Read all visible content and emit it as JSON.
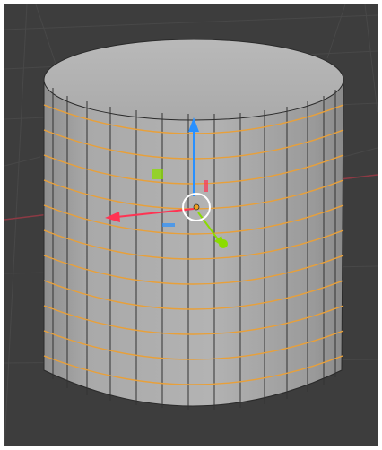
{
  "app": "Blender",
  "viewport": {
    "mode": "3d-viewport",
    "background_color": "#3d3d3d",
    "grid_color": "#474747",
    "x_axis_color": "#8c3a44",
    "selected_object": "cylinder",
    "edit_highlight_color": "#e8a03a"
  },
  "object": {
    "type": "cylinder",
    "edge_loops_selected": 11,
    "face_color": "#a8a8a8",
    "top_color": "#b6b6b6"
  },
  "gizmo": {
    "type": "translate",
    "x_axis_color": "#ff3352",
    "y_axis_color": "#8bdc00",
    "z_axis_color": "#2890ff",
    "plane_handle_color": "#8bdc00"
  }
}
